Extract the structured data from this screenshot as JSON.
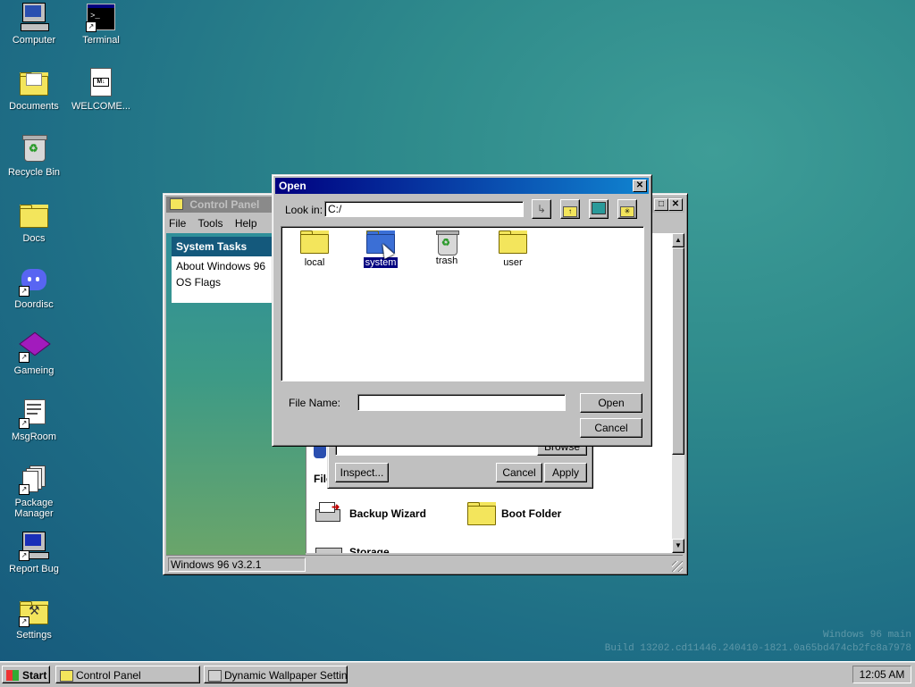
{
  "desktop": {
    "icons": [
      {
        "label": "Computer",
        "icon": "computer-icon"
      },
      {
        "label": "Terminal",
        "icon": "terminal-icon"
      },
      {
        "label": "Documents",
        "icon": "documents-folder-icon"
      },
      {
        "label": "WELCOME...",
        "icon": "markdown-file-icon"
      },
      {
        "label": "Recycle Bin",
        "icon": "recycle-bin-icon"
      },
      {
        "label": "Docs",
        "icon": "folder-icon"
      },
      {
        "label": "Doordisc",
        "icon": "doordisc-icon"
      },
      {
        "label": "Gameing",
        "icon": "game-cube-icon"
      },
      {
        "label": "MsgRoom",
        "icon": "msgroom-icon"
      },
      {
        "label": "Package Manager",
        "icon": "package-manager-icon"
      },
      {
        "label": "Report Bug",
        "icon": "report-bug-icon"
      },
      {
        "label": "Settings",
        "icon": "settings-icon"
      }
    ],
    "watermark_line1": "Windows 96 main",
    "watermark_line2": "Build 13202.cd11446.240410-1821.0a65bd474cb2fc8a7978"
  },
  "control_panel": {
    "title": "Control Panel",
    "menu": [
      "File",
      "Tools",
      "Help"
    ],
    "system_tasks_heading": "System Tasks",
    "tasks": [
      "About Windows 96",
      "OS Flags"
    ],
    "items": [
      {
        "label": "Backup Wizard",
        "icon": "backup-wizard-icon"
      },
      {
        "label": "Boot Folder",
        "icon": "folder-icon"
      },
      {
        "label": "Storage",
        "icon": "storage-icon"
      }
    ],
    "partial_label": "File",
    "status": "Windows 96 v3.2.1"
  },
  "props_dialog": {
    "browse_label": "Browse",
    "inspect_label": "Inspect...",
    "cancel_label": "Cancel",
    "apply_label": "Apply"
  },
  "open_dialog": {
    "title": "Open",
    "look_in_label": "Look in:",
    "path": "C:/",
    "files": [
      {
        "name": "local",
        "icon": "folder-icon",
        "selected": false
      },
      {
        "name": "system",
        "icon": "system-folder-icon",
        "selected": true
      },
      {
        "name": "trash",
        "icon": "recycle-bin-icon",
        "selected": false
      },
      {
        "name": "user",
        "icon": "folder-icon",
        "selected": false
      }
    ],
    "file_name_label": "File Name:",
    "file_name_value": "",
    "open_label": "Open",
    "cancel_label": "Cancel"
  },
  "taskbar": {
    "start_label": "Start",
    "tasks": [
      {
        "label": "Control Panel",
        "icon": "control-panel-icon"
      },
      {
        "label": "Dynamic Wallpaper Settings",
        "icon": "wallpaper-settings-icon"
      }
    ],
    "clock": "12:05 AM"
  },
  "colors": {
    "title_active": "#000080",
    "desktop_teal": "#2f8b8c",
    "folder_yellow": "#f3e55c",
    "folder_blue": "#3b6fd6",
    "selection": "#000080"
  }
}
